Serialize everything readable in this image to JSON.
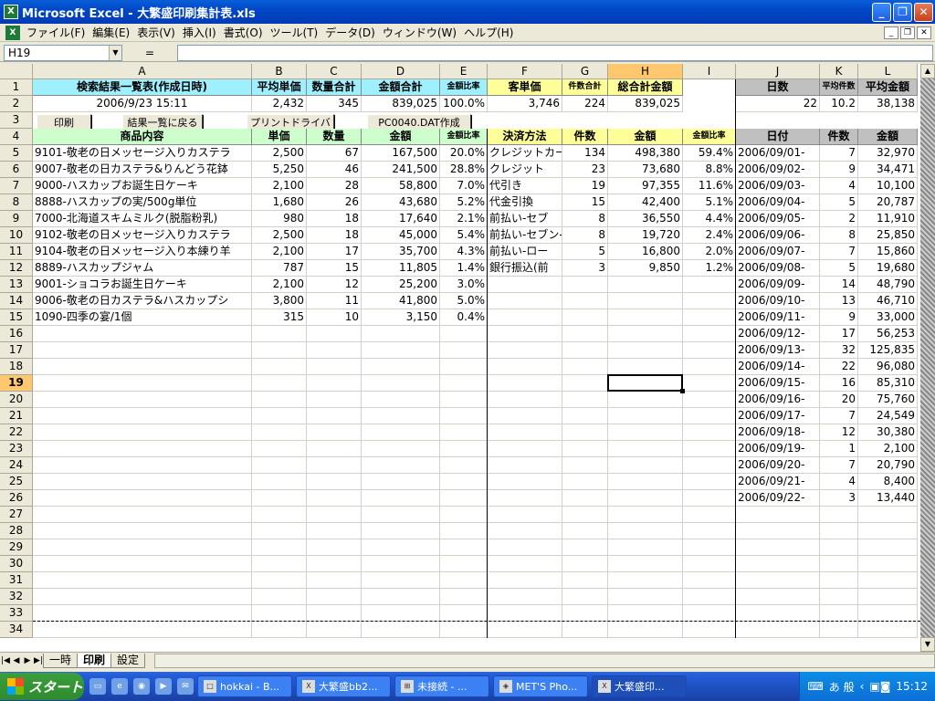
{
  "window": {
    "title": "Microsoft Excel - 大繁盛印刷集計表.xls",
    "app_icon": "excel-icon"
  },
  "menu": [
    "ファイル(F)",
    "編集(E)",
    "表示(V)",
    "挿入(I)",
    "書式(O)",
    "ツール(T)",
    "データ(D)",
    "ウィンドウ(W)",
    "ヘルプ(H)"
  ],
  "formula": {
    "namebox": "H19",
    "eq": "=",
    "content": ""
  },
  "columns": [
    "A",
    "B",
    "C",
    "D",
    "E",
    "F",
    "G",
    "H",
    "I",
    "J",
    "K",
    "L"
  ],
  "rows": [
    "1",
    "2",
    "3",
    "4",
    "5",
    "6",
    "7",
    "8",
    "9",
    "10",
    "11",
    "12",
    "13",
    "14",
    "15",
    "16",
    "17",
    "18",
    "19",
    "20",
    "21",
    "22",
    "23",
    "24",
    "25",
    "26",
    "27",
    "28",
    "29",
    "30",
    "31",
    "32",
    "33",
    "34"
  ],
  "row1": {
    "title": "検索結果一覧表(作成日時)",
    "avg_price": "平均単価",
    "qty_total": "数量合計",
    "amount_total": "金額合計",
    "ratio": "金額比率",
    "cust_price": "客単価",
    "count_total": "件数合計",
    "grand_total": "総合計金額",
    "days": "日数",
    "avg_count": "平均件数",
    "avg_amount": "平均金額"
  },
  "row2": {
    "created": "2006/9/23 15:11",
    "avg_price": "2,432",
    "qty_total": "345",
    "amount_total": "839,025",
    "ratio": "100.0%",
    "cust_price": "3,746",
    "count_total": "224",
    "grand_total": "839,025",
    "days": "22",
    "avg_count": "10.2",
    "avg_amount": "38,138"
  },
  "buttons": {
    "print": "印刷",
    "back": "結果一覧に戻る",
    "driver": "プリントドライバー",
    "dat": "PC0040.DAT作成"
  },
  "row4": {
    "item": "商品内容",
    "unit": "単価",
    "qty": "数量",
    "amount": "金額",
    "ratio": "金額比率",
    "pay": "決済方法",
    "count": "件数",
    "pamount": "金額",
    "pratio": "金額比率",
    "date": "日付",
    "dcount": "件数",
    "damount": "金額"
  },
  "items": [
    {
      "name": "9101-敬老の日メッセージ入りカステラ",
      "unit": "2,500",
      "qty": "67",
      "amount": "167,500",
      "ratio": "20.0%"
    },
    {
      "name": "9007-敬老の日カステラ&りんどう花鉢",
      "unit": "5,250",
      "qty": "46",
      "amount": "241,500",
      "ratio": "28.8%"
    },
    {
      "name": "9000-ハスカップお誕生日ケーキ",
      "unit": "2,100",
      "qty": "28",
      "amount": "58,800",
      "ratio": "7.0%"
    },
    {
      "name": "8888-ハスカップの実/500g単位",
      "unit": "1,680",
      "qty": "26",
      "amount": "43,680",
      "ratio": "5.2%"
    },
    {
      "name": "7000-北海道スキムミルク(脱脂粉乳)",
      "unit": "980",
      "qty": "18",
      "amount": "17,640",
      "ratio": "2.1%"
    },
    {
      "name": "9102-敬老の日メッセージ入りカステラ",
      "unit": "2,500",
      "qty": "18",
      "amount": "45,000",
      "ratio": "5.4%"
    },
    {
      "name": "9104-敬老の日メッセージ入り本練り羊",
      "unit": "2,100",
      "qty": "17",
      "amount": "35,700",
      "ratio": "4.3%"
    },
    {
      "name": "8889-ハスカップジャム",
      "unit": "787",
      "qty": "15",
      "amount": "11,805",
      "ratio": "1.4%"
    },
    {
      "name": "9001-ショコラお誕生日ケーキ",
      "unit": "2,100",
      "qty": "12",
      "amount": "25,200",
      "ratio": "3.0%"
    },
    {
      "name": "9006-敬老の日カステラ&ハスカップシ",
      "unit": "3,800",
      "qty": "11",
      "amount": "41,800",
      "ratio": "5.0%"
    },
    {
      "name": "1090-四季の宴/1個",
      "unit": "315",
      "qty": "10",
      "amount": "3,150",
      "ratio": "0.4%"
    }
  ],
  "payments": [
    {
      "method": "クレジットカー",
      "count": "134",
      "amount": "498,380",
      "ratio": "59.4%"
    },
    {
      "method": "クレジット",
      "count": "23",
      "amount": "73,680",
      "ratio": "8.8%"
    },
    {
      "method": "代引き",
      "count": "19",
      "amount": "97,355",
      "ratio": "11.6%"
    },
    {
      "method": "代金引換",
      "count": "15",
      "amount": "42,400",
      "ratio": "5.1%"
    },
    {
      "method": "前払い-セブ",
      "count": "8",
      "amount": "36,550",
      "ratio": "4.4%"
    },
    {
      "method": "前払い-セブン-",
      "count": "8",
      "amount": "19,720",
      "ratio": "2.4%"
    },
    {
      "method": "前払い-ロー",
      "count": "5",
      "amount": "16,800",
      "ratio": "2.0%"
    },
    {
      "method": "銀行振込(前",
      "count": "3",
      "amount": "9,850",
      "ratio": "1.2%"
    }
  ],
  "dates": [
    {
      "date": "2006/09/01-",
      "count": "7",
      "amount": "32,970"
    },
    {
      "date": "2006/09/02-",
      "count": "9",
      "amount": "34,471"
    },
    {
      "date": "2006/09/03-",
      "count": "4",
      "amount": "10,100"
    },
    {
      "date": "2006/09/04-",
      "count": "5",
      "amount": "20,787"
    },
    {
      "date": "2006/09/05-",
      "count": "2",
      "amount": "11,910"
    },
    {
      "date": "2006/09/06-",
      "count": "8",
      "amount": "25,850"
    },
    {
      "date": "2006/09/07-",
      "count": "7",
      "amount": "15,860"
    },
    {
      "date": "2006/09/08-",
      "count": "5",
      "amount": "19,680"
    },
    {
      "date": "2006/09/09-",
      "count": "14",
      "amount": "48,790"
    },
    {
      "date": "2006/09/10-",
      "count": "13",
      "amount": "46,710"
    },
    {
      "date": "2006/09/11-",
      "count": "9",
      "amount": "33,000"
    },
    {
      "date": "2006/09/12-",
      "count": "17",
      "amount": "56,253"
    },
    {
      "date": "2006/09/13-",
      "count": "32",
      "amount": "125,835"
    },
    {
      "date": "2006/09/14-",
      "count": "22",
      "amount": "96,080"
    },
    {
      "date": "2006/09/15-",
      "count": "16",
      "amount": "85,310"
    },
    {
      "date": "2006/09/16-",
      "count": "20",
      "amount": "75,760"
    },
    {
      "date": "2006/09/17-",
      "count": "7",
      "amount": "24,549"
    },
    {
      "date": "2006/09/18-",
      "count": "12",
      "amount": "30,380"
    },
    {
      "date": "2006/09/19-",
      "count": "1",
      "amount": "2,100"
    },
    {
      "date": "2006/09/20-",
      "count": "7",
      "amount": "20,790"
    },
    {
      "date": "2006/09/21-",
      "count": "4",
      "amount": "8,400"
    },
    {
      "date": "2006/09/22-",
      "count": "3",
      "amount": "13,440"
    }
  ],
  "sheets": {
    "tabs": [
      "一時",
      "印刷",
      "設定"
    ],
    "active": "印刷"
  },
  "taskbar": {
    "start": "スタート",
    "tasks": [
      "hokkai - B...",
      "大繁盛bb2...",
      "未接続 - ...",
      "MET'S Pho...",
      "大繁盛印..."
    ],
    "active": "大繁盛印...",
    "ime": "あ 般",
    "clock": "15:12"
  },
  "colors": {
    "title_bg": "#0047c8",
    "cyan": "#9ef0ff",
    "yellow": "#ffff99",
    "green": "#ccffcc",
    "gray": "#c0c0c0",
    "selected_header": "#ffc86e"
  }
}
